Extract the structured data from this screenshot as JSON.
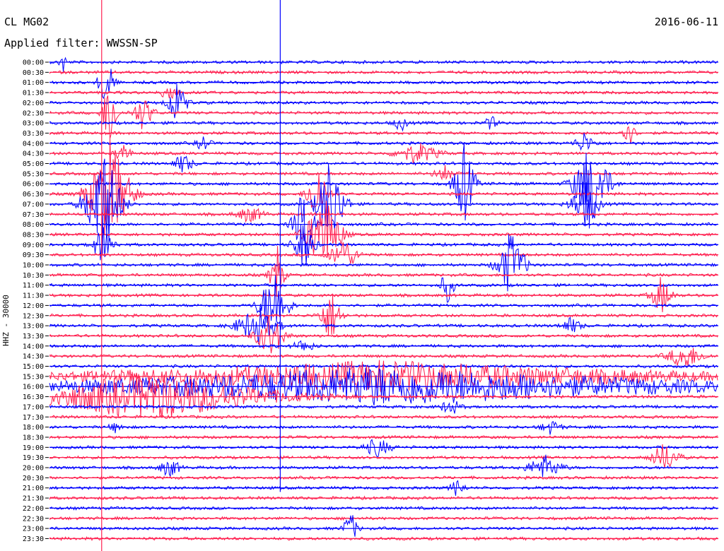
{
  "header": {
    "station": "CL MG02",
    "date": "2016-06-11",
    "filter": "Applied filter: WWSSN-SP"
  },
  "chart_data": {
    "type": "line",
    "title": "CL MG02",
    "subtitle": "Applied filter: WWSSN-SP",
    "date": "2016-06-11",
    "ylabel": "HHZ - 30000",
    "xlabel": "",
    "trace_minutes_per_line": 30,
    "trace_times": [
      "00:00",
      "00:30",
      "01:00",
      "01:30",
      "02:00",
      "02:30",
      "03:00",
      "03:30",
      "04:00",
      "04:30",
      "05:00",
      "05:30",
      "06:00",
      "06:30",
      "07:00",
      "07:30",
      "08:00",
      "08:30",
      "09:00",
      "09:30",
      "10:00",
      "10:30",
      "11:00",
      "11:30",
      "12:00",
      "12:30",
      "13:00",
      "13:30",
      "14:00",
      "14:30",
      "15:00",
      "15:30",
      "16:00",
      "16:30",
      "17:00",
      "17:30",
      "18:00",
      "18:30",
      "19:00",
      "19:30",
      "20:00",
      "20:30",
      "21:00",
      "21:30",
      "22:00",
      "22:30",
      "23:00",
      "23:30"
    ],
    "colors": {
      "even": "#0000ff",
      "odd": "#ff1f4f"
    },
    "events": [
      {
        "trace": 0,
        "x": 0.02,
        "amp": 18,
        "width": 0.01
      },
      {
        "trace": 2,
        "x": 0.085,
        "amp": 50,
        "width": 0.02
      },
      {
        "trace": 3,
        "x": 0.18,
        "amp": 22,
        "width": 0.02
      },
      {
        "trace": 4,
        "x": 0.19,
        "amp": 30,
        "width": 0.03
      },
      {
        "trace": 5,
        "x": 0.14,
        "amp": 25,
        "width": 0.03
      },
      {
        "trace": 5,
        "x": 0.09,
        "amp": 60,
        "width": 0.02
      },
      {
        "trace": 6,
        "x": 0.525,
        "amp": 12,
        "width": 0.02
      },
      {
        "trace": 6,
        "x": 0.66,
        "amp": 10,
        "width": 0.02
      },
      {
        "trace": 7,
        "x": 0.865,
        "amp": 22,
        "width": 0.02
      },
      {
        "trace": 8,
        "x": 0.23,
        "amp": 12,
        "width": 0.02
      },
      {
        "trace": 8,
        "x": 0.8,
        "amp": 15,
        "width": 0.03
      },
      {
        "trace": 9,
        "x": 0.11,
        "amp": 18,
        "width": 0.02
      },
      {
        "trace": 9,
        "x": 0.55,
        "amp": 16,
        "width": 0.06
      },
      {
        "trace": 10,
        "x": 0.2,
        "amp": 14,
        "width": 0.03
      },
      {
        "trace": 11,
        "x": 0.59,
        "amp": 12,
        "width": 0.03
      },
      {
        "trace": 12,
        "x": 0.81,
        "amp": 70,
        "width": 0.05
      },
      {
        "trace": 12,
        "x": 0.62,
        "amp": 60,
        "width": 0.03
      },
      {
        "trace": 13,
        "x": 0.09,
        "amp": 80,
        "width": 0.06
      },
      {
        "trace": 13,
        "x": 0.4,
        "amp": 50,
        "width": 0.03
      },
      {
        "trace": 14,
        "x": 0.08,
        "amp": 90,
        "width": 0.05
      },
      {
        "trace": 14,
        "x": 0.42,
        "amp": 70,
        "width": 0.04
      },
      {
        "trace": 14,
        "x": 0.8,
        "amp": 35,
        "width": 0.04
      },
      {
        "trace": 15,
        "x": 0.3,
        "amp": 12,
        "width": 0.04
      },
      {
        "trace": 16,
        "x": 0.38,
        "amp": 55,
        "width": 0.03
      },
      {
        "trace": 17,
        "x": 0.41,
        "amp": 60,
        "width": 0.05
      },
      {
        "trace": 18,
        "x": 0.08,
        "amp": 30,
        "width": 0.03
      },
      {
        "trace": 18,
        "x": 0.38,
        "amp": 40,
        "width": 0.03
      },
      {
        "trace": 19,
        "x": 0.44,
        "amp": 25,
        "width": 0.04
      },
      {
        "trace": 20,
        "x": 0.69,
        "amp": 50,
        "width": 0.04
      },
      {
        "trace": 21,
        "x": 0.34,
        "amp": 45,
        "width": 0.02
      },
      {
        "trace": 22,
        "x": 0.595,
        "amp": 25,
        "width": 0.02
      },
      {
        "trace": 23,
        "x": 0.915,
        "amp": 28,
        "width": 0.03
      },
      {
        "trace": 24,
        "x": 0.335,
        "amp": 55,
        "width": 0.04
      },
      {
        "trace": 25,
        "x": 0.42,
        "amp": 40,
        "width": 0.03
      },
      {
        "trace": 26,
        "x": 0.31,
        "amp": 28,
        "width": 0.06
      },
      {
        "trace": 26,
        "x": 0.78,
        "amp": 12,
        "width": 0.03
      },
      {
        "trace": 27,
        "x": 0.33,
        "amp": 35,
        "width": 0.04
      },
      {
        "trace": 28,
        "x": 0.38,
        "amp": 10,
        "width": 0.03
      },
      {
        "trace": 29,
        "x": 0.95,
        "amp": 20,
        "width": 0.05
      },
      {
        "trace": 31,
        "x": 0.5,
        "amp": 22,
        "width": 0.9
      },
      {
        "trace": 32,
        "x": 0.5,
        "amp": 28,
        "width": 0.95
      },
      {
        "trace": 33,
        "x": 0.15,
        "amp": 35,
        "width": 0.35
      },
      {
        "trace": 34,
        "x": 0.6,
        "amp": 12,
        "width": 0.03
      },
      {
        "trace": 36,
        "x": 0.1,
        "amp": 8,
        "width": 0.02
      },
      {
        "trace": 36,
        "x": 0.75,
        "amp": 10,
        "width": 0.03
      },
      {
        "trace": 38,
        "x": 0.49,
        "amp": 14,
        "width": 0.04
      },
      {
        "trace": 39,
        "x": 0.92,
        "amp": 22,
        "width": 0.04
      },
      {
        "trace": 40,
        "x": 0.18,
        "amp": 14,
        "width": 0.03
      },
      {
        "trace": 40,
        "x": 0.74,
        "amp": 18,
        "width": 0.05
      },
      {
        "trace": 42,
        "x": 0.61,
        "amp": 14,
        "width": 0.02
      },
      {
        "trace": 46,
        "x": 0.45,
        "amp": 25,
        "width": 0.02
      }
    ],
    "spikes": [
      {
        "x": 0.078,
        "from_trace": 0,
        "to_trace": 47,
        "color": "odd"
      },
      {
        "x": 0.345,
        "from_trace": 0,
        "to_trace": 41,
        "color": "even"
      }
    ]
  }
}
